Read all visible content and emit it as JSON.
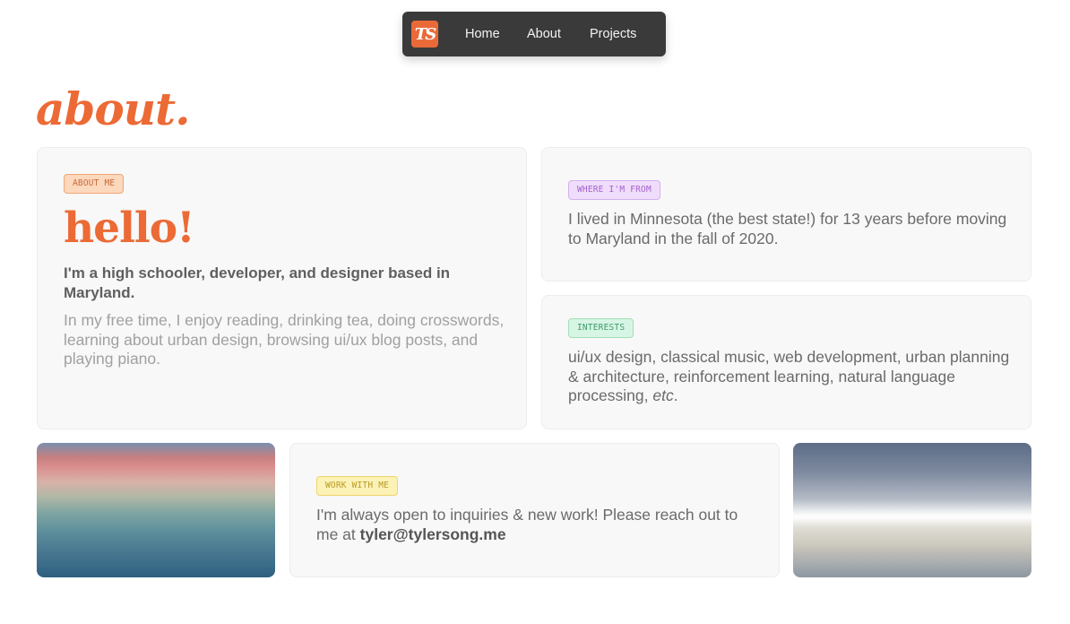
{
  "nav": {
    "logo_text": "TS",
    "links": [
      "Home",
      "About",
      "Projects"
    ]
  },
  "page_title": "about.",
  "about_card": {
    "tag": "ABOUT ME",
    "heading": "hello!",
    "intro": "I'm a high schooler, developer, and designer based in Maryland.",
    "free_time": "In my free time, I enjoy reading, drinking tea, doing crosswords, learning about urban design, browsing ui/ux blog posts, and playing piano."
  },
  "from_card": {
    "tag": "WHERE I'M FROM",
    "text": "I lived in Minnesota (the best state!) for 13 years before moving to Maryland in the fall of 2020."
  },
  "interests_card": {
    "tag": "INTERESTS",
    "text_before": "ui/ux design, classical music, web development, urban planning & architecture, reinforcement learning, natural language processing, ",
    "text_etc": "etc",
    "text_after": "."
  },
  "work_card": {
    "tag": "WORK WITH ME",
    "text": "I'm always open to inquiries & new work! Please reach out to me at ",
    "email": "tyler@tylersong.me"
  },
  "colors": {
    "accent": "#ec6a35",
    "nav_bg": "#3a3a3a",
    "card_bg": "#f7f8f7"
  }
}
